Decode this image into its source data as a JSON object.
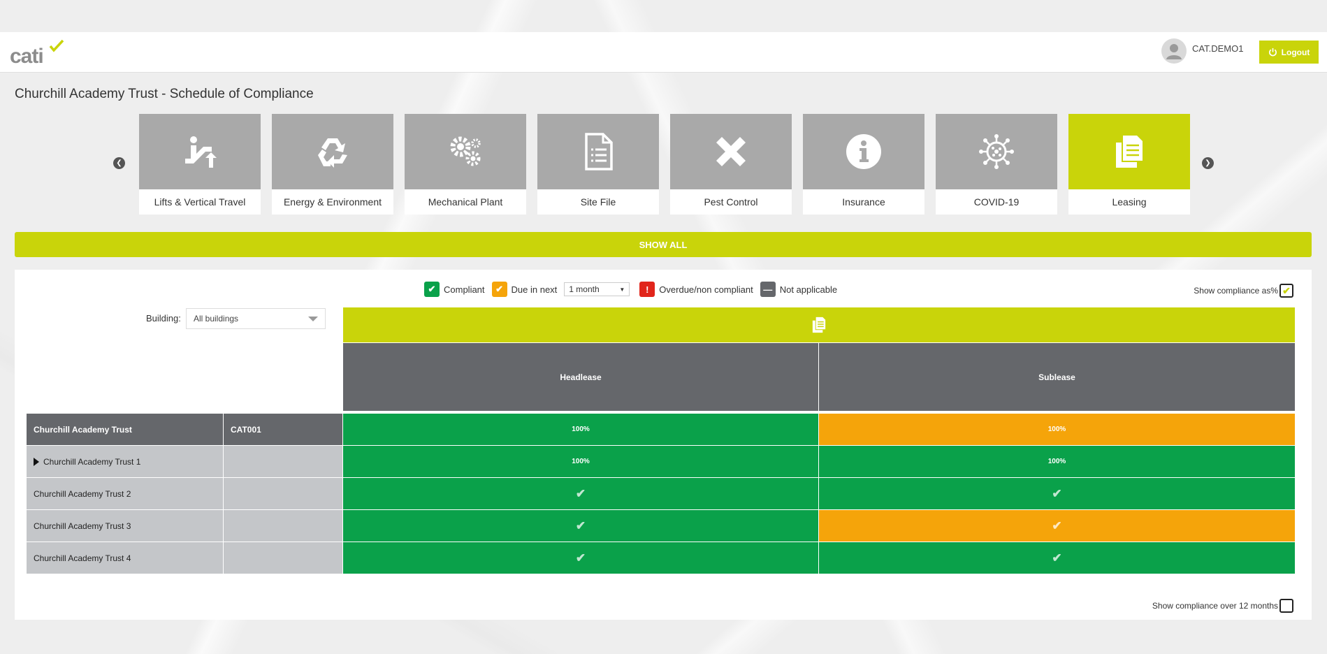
{
  "header": {
    "logo_text": "cati",
    "username": "CAT.DEMO1",
    "logout_label": "Logout"
  },
  "page_title": "Churchill Academy Trust - Schedule of Compliance",
  "categories": [
    {
      "label": "Lifts & Vertical Travel",
      "icon": "escalator-icon"
    },
    {
      "label": "Energy & Environment",
      "icon": "recycle-icon"
    },
    {
      "label": "Mechanical Plant",
      "icon": "gears-icon"
    },
    {
      "label": "Site File",
      "icon": "document-icon"
    },
    {
      "label": "Pest Control",
      "icon": "cross-icon"
    },
    {
      "label": "Insurance",
      "icon": "info-icon"
    },
    {
      "label": "COVID-19",
      "icon": "virus-icon"
    },
    {
      "label": "Leasing",
      "icon": "copy-document-icon",
      "active": true
    }
  ],
  "show_all_label": "SHOW ALL",
  "legend": {
    "compliant": "Compliant",
    "due_in_next": "Due in next",
    "period_value": "1 month",
    "overdue": "Overdue/non compliant",
    "not_applicable": "Not applicable"
  },
  "show_pct_label": "Show compliance as%",
  "building": {
    "label": "Building:",
    "value": "All buildings"
  },
  "columns": [
    "Headlease",
    "Sublease"
  ],
  "rows": [
    {
      "name": "Churchill Academy Trust",
      "code": "CAT001",
      "cells": [
        "100%",
        "100%"
      ]
    },
    {
      "name": "Churchill Academy Trust 1",
      "code": "",
      "cells": [
        "100%",
        "100%"
      ]
    },
    {
      "name": "Churchill Academy Trust 2",
      "code": "",
      "cells": [
        "✔",
        "✔"
      ]
    },
    {
      "name": "Churchill Academy Trust 3",
      "code": "",
      "cells": [
        "✔",
        "✔"
      ]
    },
    {
      "name": "Churchill Academy Trust 4",
      "code": "",
      "cells": [
        "✔",
        "✔"
      ]
    }
  ],
  "cell_status": [
    [
      "compliant",
      "due"
    ],
    [
      "compliant",
      "compliant"
    ],
    [
      "compliant",
      "compliant"
    ],
    [
      "compliant",
      "due"
    ],
    [
      "compliant",
      "compliant"
    ]
  ],
  "colors": {
    "brand": "#c9d40a",
    "compliant": "#0aa14a",
    "due": "#f5a40a",
    "overdue": "#e1251b",
    "not_applicable": "#65676b"
  },
  "show_12_months_label": "Show compliance over 12 months"
}
